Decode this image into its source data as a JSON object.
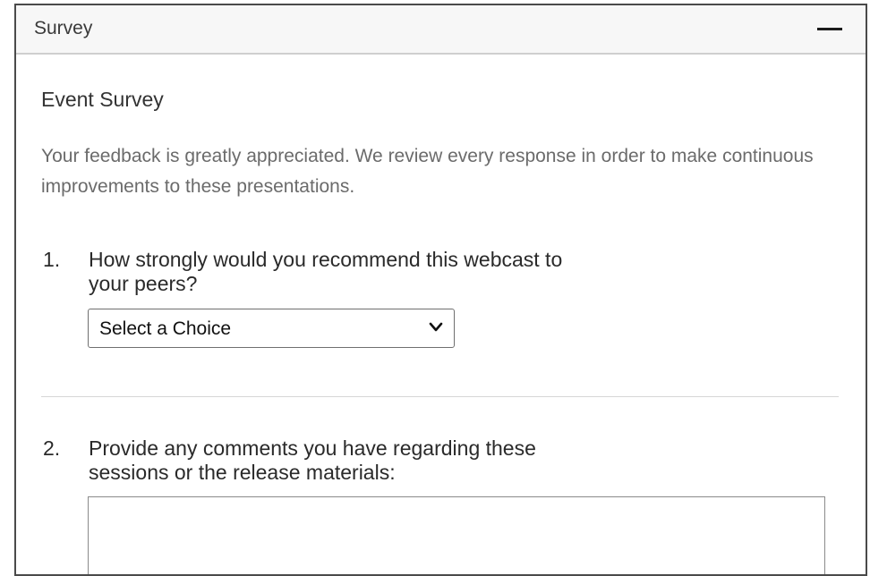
{
  "header": {
    "title": "Survey",
    "collapse_icon": "minus-icon"
  },
  "survey": {
    "title": "Event Survey",
    "intro": "Your feedback is greatly appreciated. We review every response in order to make continuous improvements to these presentations.",
    "questions": [
      {
        "number": "1.",
        "text_line1": "How strongly would you recommend this webcast to",
        "text_line2": "your peers?",
        "input_type": "select",
        "selected_value": "Select a Choice",
        "chevron_icon": "chevron-down-icon"
      },
      {
        "number": "2.",
        "text_line1": "Provide any comments you have regarding these",
        "text_line2": "sessions or the release materials:",
        "input_type": "textarea",
        "value": ""
      }
    ]
  }
}
